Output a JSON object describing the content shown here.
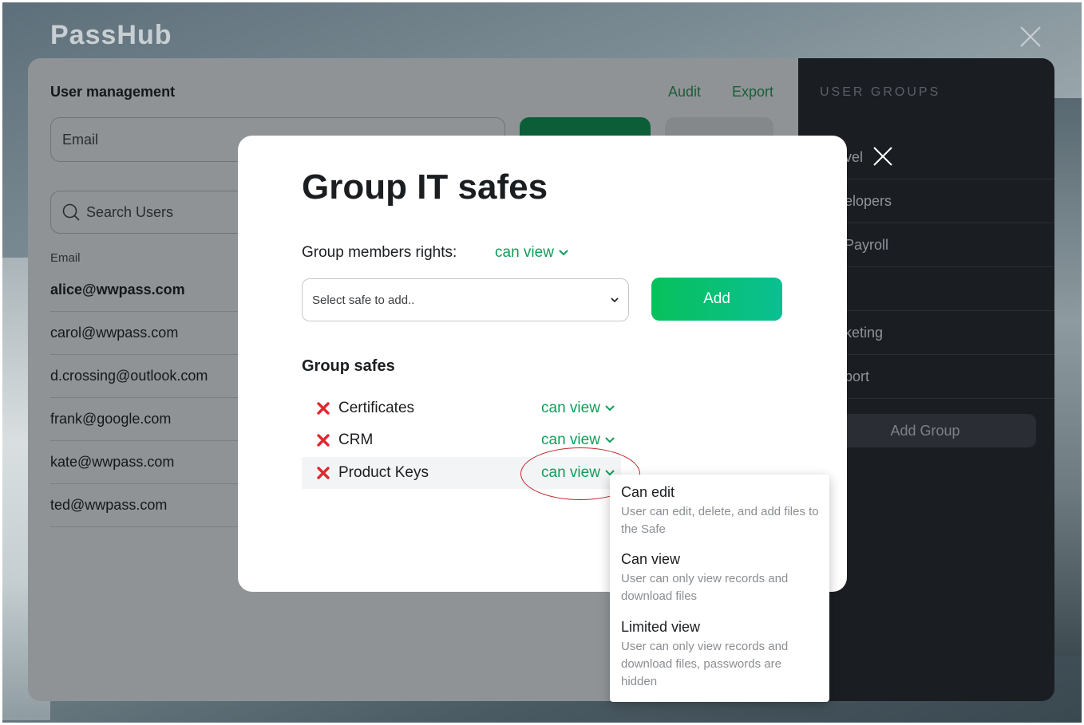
{
  "app": {
    "logo": "PassHub"
  },
  "background_panel": {
    "title": "User management",
    "links": [
      "Audit",
      "Export"
    ],
    "email_placeholder": "Email",
    "search_placeholder": "Search Users",
    "column_header": "Email",
    "users": [
      "alice@wwpass.com",
      "carol@wwpass.com",
      "d.crossing@outlook.com",
      "frank@google.com",
      "kate@wwpass.com",
      "ted@wwpass.com"
    ]
  },
  "side_panel": {
    "header": "USER GROUPS",
    "groups": [
      "vel",
      "elopers",
      "Payroll",
      "",
      "keting",
      "port"
    ],
    "add_group_label": "Add Group"
  },
  "modal": {
    "title": "Group IT safes",
    "rights_label": "Group members rights:",
    "rights_value": "can view",
    "select_placeholder": "Select safe to add..",
    "add_button": "Add",
    "safes_header": "Group safes",
    "safes": [
      {
        "name": "Certificates",
        "right": "can view"
      },
      {
        "name": "CRM",
        "right": "can view"
      },
      {
        "name": "Product Keys",
        "right": "can view"
      }
    ]
  },
  "dropdown": {
    "options": [
      {
        "title": "Can edit",
        "description": "User can edit, delete, and add files to the Safe"
      },
      {
        "title": "Can view",
        "description": "User can only view records and download files"
      },
      {
        "title": "Limited view",
        "description": "User can only view records and download files, passwords are hidden"
      }
    ]
  },
  "colors": {
    "accent_green": "#0f9d58",
    "remove_red": "#e3262d",
    "annotation_red": "#c0282d",
    "side_panel_bg": "#1a1d22"
  },
  "icons": [
    "close-icon",
    "search-icon",
    "chevron-down-icon",
    "remove-icon"
  ]
}
